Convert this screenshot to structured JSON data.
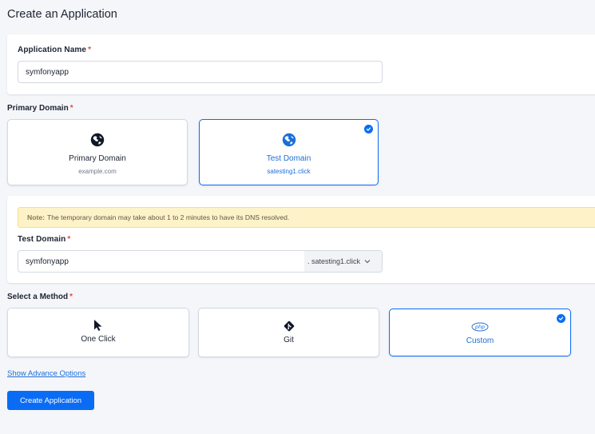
{
  "page": {
    "title": "Create an Application"
  },
  "app_name": {
    "label": "Application Name",
    "required_mark": "*",
    "value": "symfonyapp"
  },
  "primary_domain": {
    "label": "Primary Domain",
    "required_mark": "*",
    "options": [
      {
        "title": "Primary Domain",
        "subtitle": "example.com",
        "icon": "globe-icon",
        "selected": false
      },
      {
        "title": "Test Domain",
        "subtitle": "satesting1.click",
        "icon": "globe-icon",
        "selected": true
      }
    ]
  },
  "test_domain": {
    "note_prefix": "Note:",
    "note_text": "The temporary domain may take about 1 to 2 minutes to have its DNS resolved.",
    "label": "Test Domain",
    "required_mark": "*",
    "value": "symfonyapp",
    "suffix": ". satesting1.click"
  },
  "method": {
    "label": "Select a Method",
    "required_mark": "*",
    "options": [
      {
        "title": "One Click",
        "icon": "cursor-icon",
        "selected": false
      },
      {
        "title": "Git",
        "icon": "git-icon",
        "selected": false
      },
      {
        "title": "Custom",
        "icon": "php-icon",
        "selected": true
      }
    ]
  },
  "advanced_link": "Show Advance Options",
  "submit_label": "Create Application",
  "colors": {
    "accent": "#0a6cf5",
    "required": "#e5484d",
    "note_bg": "#fdf2c8",
    "background": "#f5f6fa"
  }
}
